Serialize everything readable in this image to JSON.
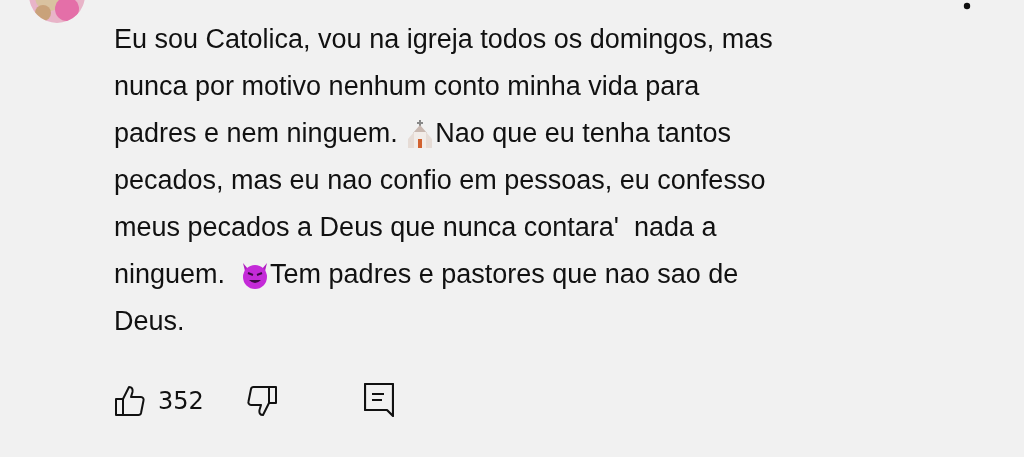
{
  "comment": {
    "lines": [
      [
        {
          "kind": "text",
          "text": "Eu sou Catolica, vou na igreja todos os domingos, mas"
        }
      ],
      [
        {
          "kind": "text",
          "text": "nunca por motivo nenhum conto minha vida para"
        }
      ],
      [
        {
          "kind": "text",
          "text": "padres e nem ninguem. "
        },
        {
          "kind": "church"
        },
        {
          "kind": "text",
          "text": "Nao que eu tenha tantos"
        }
      ],
      [
        {
          "kind": "text",
          "text": "pecados, mas eu nao confio em pessoas, eu confesso"
        }
      ],
      [
        {
          "kind": "text",
          "text": "meus pecados a Deus que nunca contara'  nada a"
        }
      ],
      [
        {
          "kind": "text",
          "text": "ninguem.  "
        },
        {
          "kind": "devil"
        },
        {
          "kind": "text",
          "text": "Tem padres e pastores que nao sao de"
        }
      ],
      [
        {
          "kind": "text",
          "text": "Deus."
        }
      ]
    ]
  },
  "actions": {
    "like_count": "352"
  }
}
